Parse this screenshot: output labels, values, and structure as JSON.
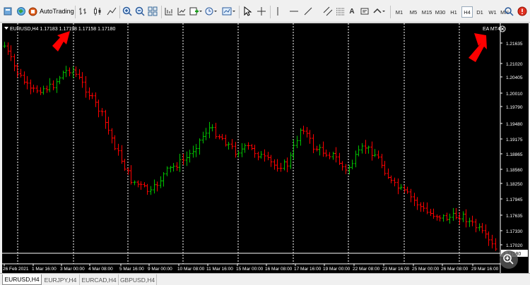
{
  "toolbar": {
    "autotrading_label": "AutoTrading",
    "timeframes": [
      "M1",
      "M5",
      "M15",
      "M30",
      "H1",
      "H4",
      "D1",
      "W1",
      "MN"
    ],
    "active_timeframe": "H4",
    "text_tool_label": "A"
  },
  "chart": {
    "header_text": "EURUSD,H4  1.17183 1.17198 1.17158 1.17180",
    "ea_label": "EA MT4",
    "current_price": "1.17180",
    "price_labels": [
      "1.21635",
      "1.21020",
      "1.20405",
      "1.20010",
      "1.19790",
      "1.19480",
      "1.19175",
      "1.18865",
      "1.18560",
      "1.18250",
      "1.17945",
      "1.17635",
      "1.17330",
      "1.17020"
    ],
    "time_labels": [
      "26 Feb 2021",
      "1 Mar 16:00",
      "3 Mar 00:00",
      "4 Mar 08:00",
      "5 Mar 16:00",
      "9 Mar 00:00",
      "10 Mar 08:00",
      "11 Mar 16:00",
      "15 Mar 00:00",
      "16 Mar 08:00",
      "17 Mar 16:00",
      "19 Mar 00:00",
      "22 Mar 08:00",
      "23 Mar 16:00",
      "25 Mar 00:00",
      "26 Mar 08:00",
      "29 Mar 16:00"
    ],
    "colors": {
      "bull": "#00c000",
      "bear": "#ff0000",
      "grid": "#ffffff",
      "background": "#000000",
      "arrow": "#ff0000"
    }
  },
  "tabs": [
    {
      "label": "EURUSD,H4",
      "active": true
    },
    {
      "label": "EURJPY,H4",
      "active": false
    },
    {
      "label": "EURCAD,H4",
      "active": false
    },
    {
      "label": "GBPUSD,H4",
      "active": false
    }
  ]
}
